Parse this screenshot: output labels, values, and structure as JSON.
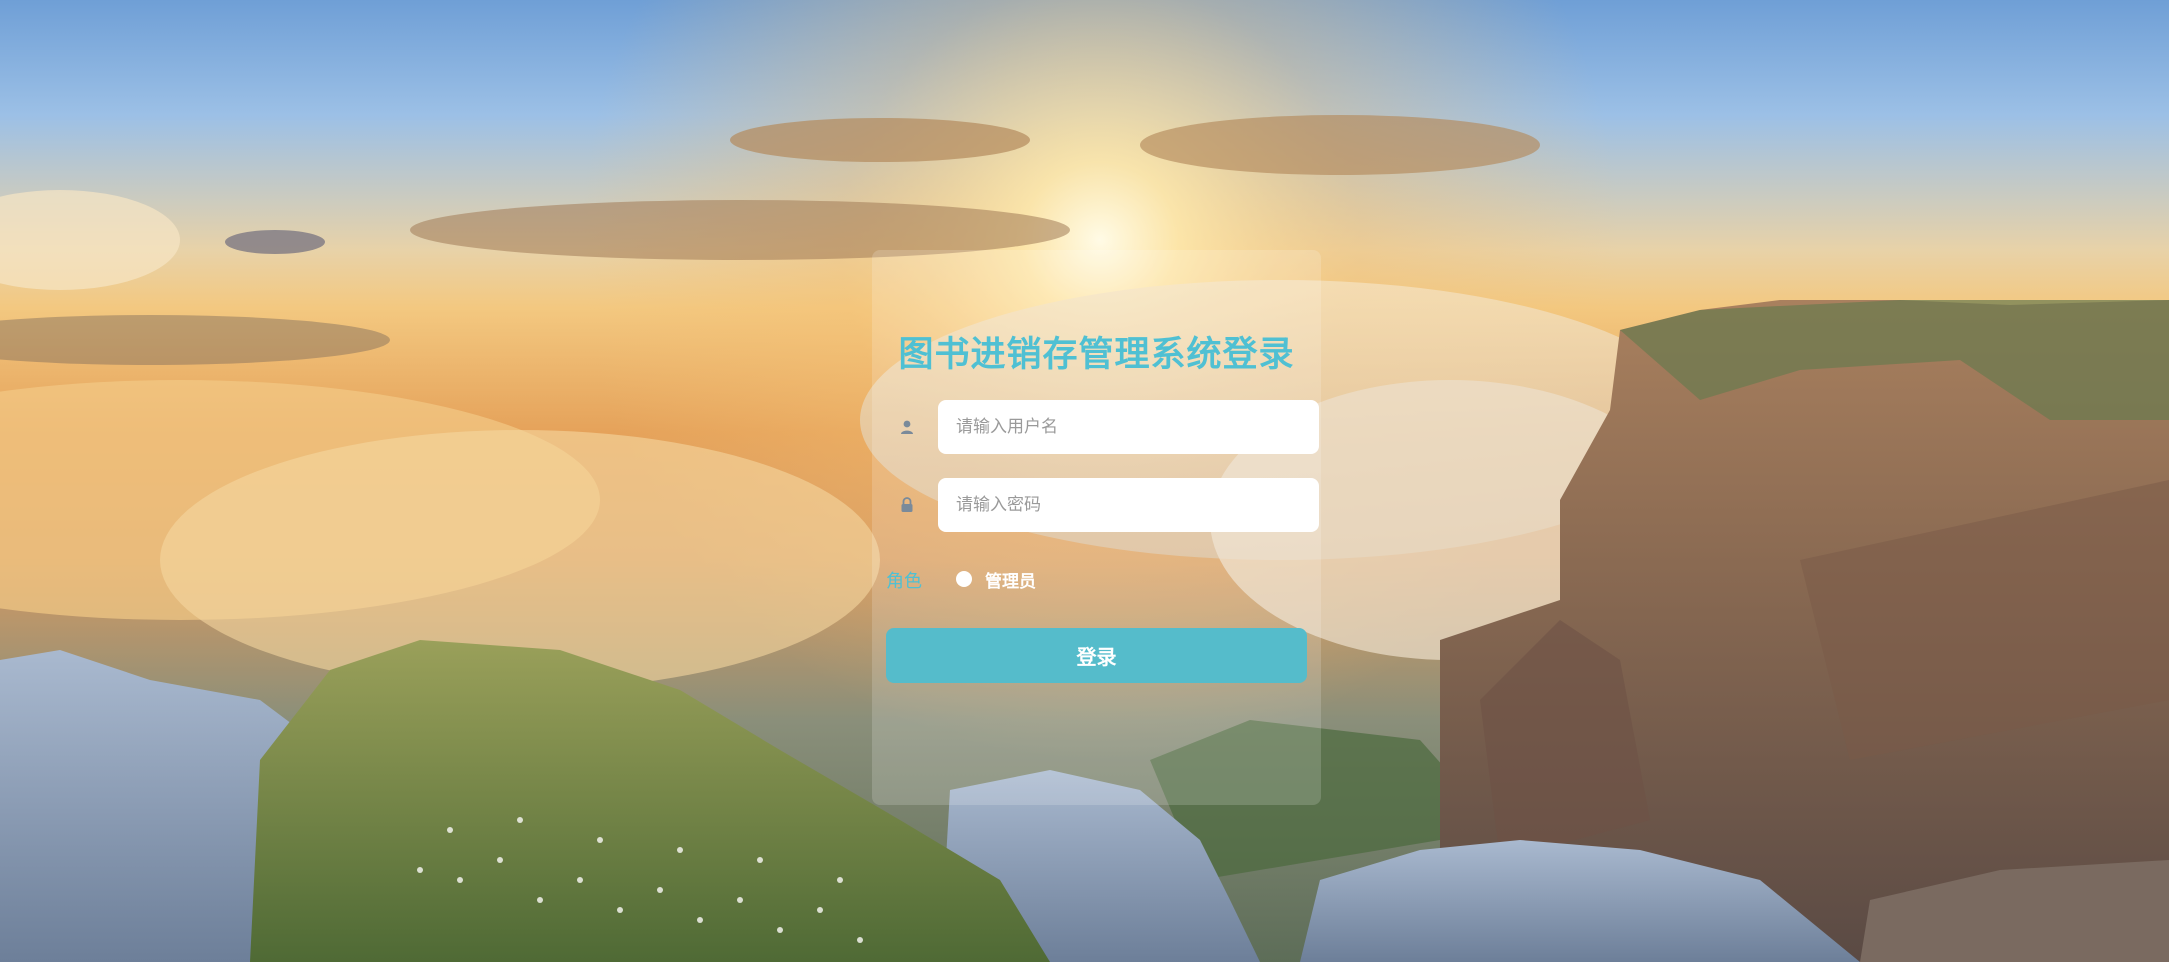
{
  "login": {
    "title": "图书进销存管理系统登录",
    "username": {
      "placeholder": "请输入用户名",
      "value": ""
    },
    "password": {
      "placeholder": "请输入密码",
      "value": ""
    },
    "role": {
      "label": "角色",
      "selected": "管理员",
      "options": [
        "管理员"
      ]
    },
    "submit_label": "登录"
  },
  "colors": {
    "accent": "#4fc0d3",
    "button": "#55bccb",
    "input_bg": "#ffffff"
  },
  "icons": {
    "username": "user-icon",
    "password": "lock-icon"
  }
}
